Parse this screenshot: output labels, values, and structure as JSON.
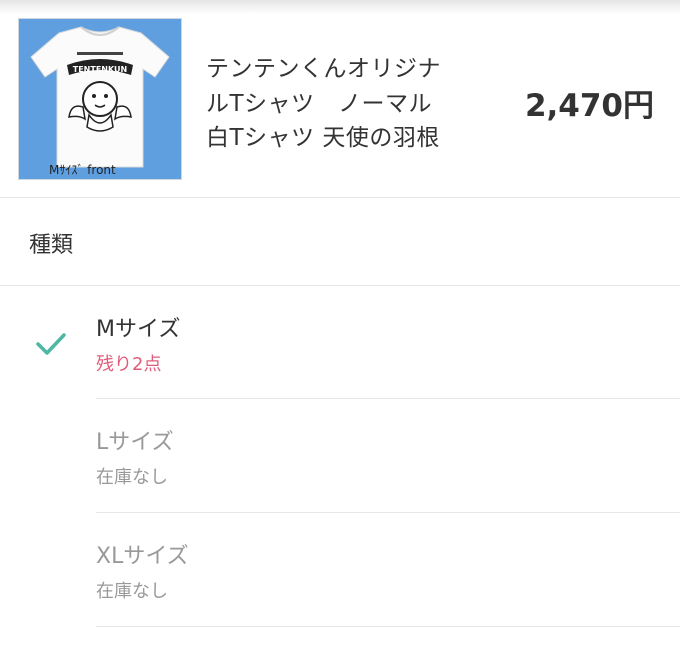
{
  "product": {
    "image_caption": "Mｻｲｽﾞ front",
    "image_logo_text": "TENTENKUN",
    "name_lines": [
      "テンテンくんオリジナ",
      "ルTシャツ　ノーマル",
      "白Tシャツ 天使の羽根"
    ],
    "price": "2,470円"
  },
  "section": {
    "title": "種類"
  },
  "variants": [
    {
      "name": "Mサイズ",
      "stock": "残り2点",
      "selected": true
    },
    {
      "name": "Lサイズ",
      "stock": "在庫なし",
      "selected": false
    },
    {
      "name": "XLサイズ",
      "stock": "在庫なし",
      "selected": false
    }
  ],
  "colors": {
    "check": "#4db6a4",
    "low_stock": "#e05c7a",
    "muted": "#999999",
    "thumb_bg": "#5f9fe0"
  },
  "icons": {
    "selected_indicator": "check-icon"
  }
}
